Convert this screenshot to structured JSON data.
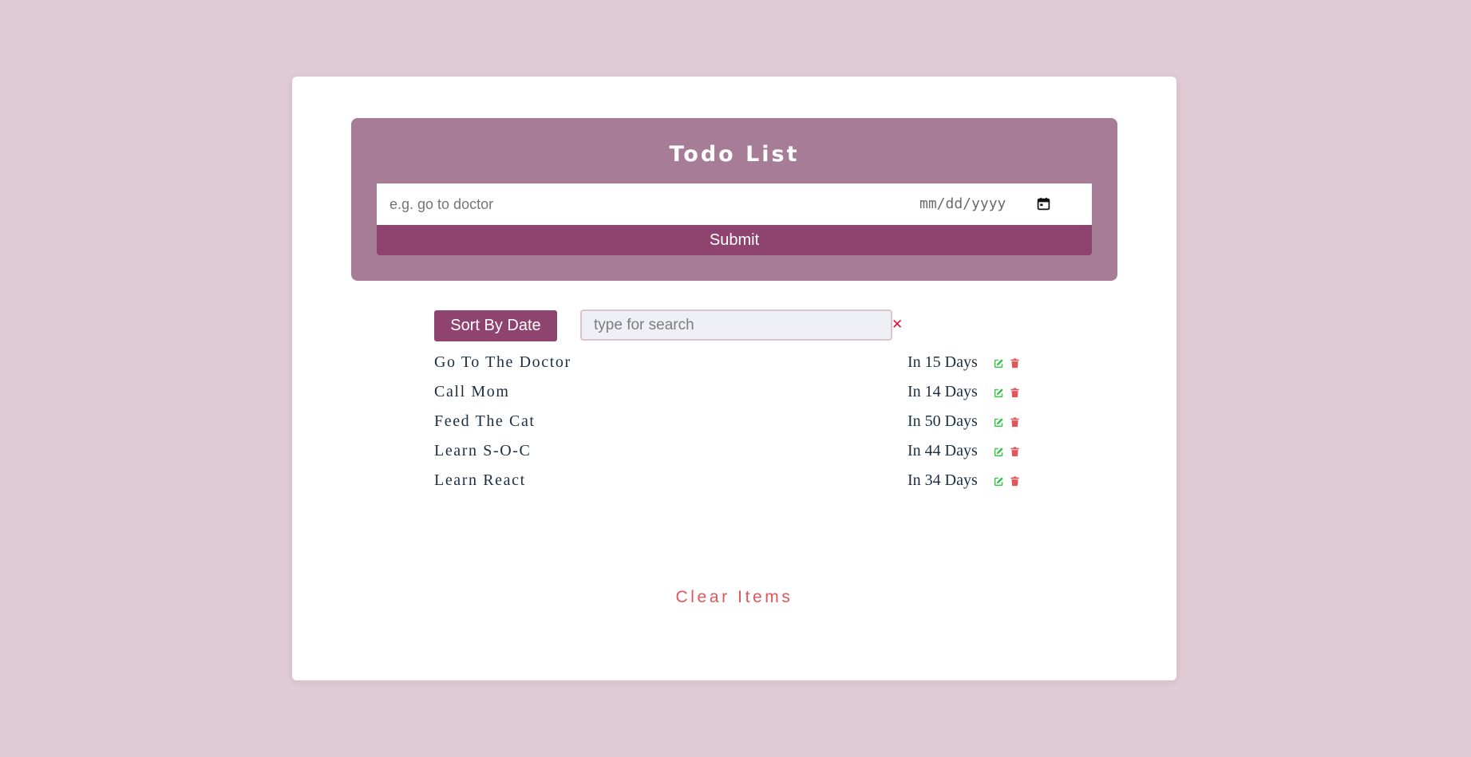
{
  "header": {
    "title": "Todo List",
    "input_placeholder": "e.g. go to doctor",
    "date_placeholder": "mm/dd/yyyy",
    "submit_label": "Submit"
  },
  "controls": {
    "sort_label": "Sort By Date",
    "search_placeholder": "type for search",
    "clear_search_glyph": "✕"
  },
  "todos": [
    {
      "title": "Go To The Doctor",
      "due": "In 15 Days"
    },
    {
      "title": "Call Mom",
      "due": "In 14 Days"
    },
    {
      "title": "Feed The Cat",
      "due": "In 50 Days"
    },
    {
      "title": "Learn S-O-C",
      "due": "In 44 Days"
    },
    {
      "title": "Learn React",
      "due": "In 34 Days"
    }
  ],
  "footer": {
    "clear_label": "Clear Items"
  },
  "icons": {
    "edit": "edit-icon",
    "delete": "trash-icon",
    "calendar": "calendar-icon"
  },
  "colors": {
    "page_background": "#e0cad3",
    "header_panel": "#a67c97",
    "accent": "#8e446e",
    "edit_icon": "#39c24c",
    "delete_icon": "#e0565b",
    "clear_items": "#e0565b",
    "clear_search": "#e0102e",
    "item_text": "#1c2e44"
  }
}
